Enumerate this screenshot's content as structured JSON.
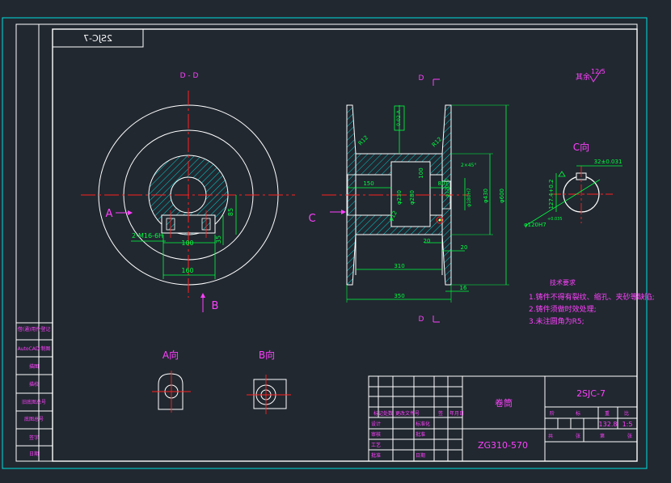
{
  "drawing": {
    "code_mirrored": "2SJC-7",
    "roughness_label": "其余",
    "roughness_value": "12.5",
    "view_dd_title": "D - D",
    "section_letter_d_top": "D",
    "section_letter_d_bottom": "D",
    "arrow_label_a": "A",
    "arrow_label_b": "B",
    "arrow_label_c": "C",
    "view_c_title": "C向",
    "view_a_title": "A向",
    "view_b_title": "B向"
  },
  "dimensions": {
    "dd_thread": "2-M16-6H",
    "dd_100": "100",
    "dd_160": "160",
    "dd_85": "85",
    "dd_35": "35",
    "s_150": "150",
    "s_80": "80",
    "s_20a": "20",
    "s_20b": "20",
    "s_310": "310",
    "s_350": "350",
    "s_16": "16",
    "s_chamfer": "2×45°",
    "s_d230": "φ230",
    "s_d280": "φ280",
    "s_d430": "φ430",
    "s_d600": "φ600",
    "s_d120": "φ120H7",
    "s_d180": "φ180H7",
    "s_100": "100",
    "s_r12": "R12",
    "s_d12": "φ12",
    "s_tol": "0.02 A",
    "c_32": "32±0.031",
    "c_127": "127.4+0.2",
    "c_120": "φ120H7",
    "c_tol": "+0.035"
  },
  "notes": {
    "title": "技术要求",
    "items": [
      "1.铸件不得有裂纹、缩孔、夹砂等缺陷;",
      "2.铸件须做时效处理;",
      "3.未注圆角为R5;"
    ]
  },
  "title_block": {
    "part_name": "卷筒",
    "material": "ZG310-570",
    "drawing_no": "2SJC-7",
    "weight": "132.8",
    "scale": "1:5",
    "hdr_stage": "阶",
    "hdr_mark": "标",
    "hdr_weight": "重",
    "hdr_scale": "比",
    "total_sheets": "共",
    "sheet": "张",
    "sheet_no": "第",
    "sheet_no2": "张",
    "mark_row": [
      "标记",
      "处数",
      "更改文件号",
      "签",
      "年月日"
    ],
    "left_rows": [
      "设计",
      "审核",
      "工艺"
    ],
    "left_rows2": [
      "标准化",
      "批准",
      "日期"
    ],
    "approval_rows": [
      "设计",
      "校对",
      "审核",
      "工艺",
      "标准化",
      "批准"
    ]
  },
  "sidebar": {
    "rows": [
      "借(通)用件登记",
      "AutoCAD 制图",
      "描图",
      "描校",
      "旧底图总号",
      "底图总号",
      "签字",
      "日期"
    ]
  },
  "colors": {
    "background": "#212830",
    "frame": "#00e0e0",
    "outline": "#ffffff",
    "center": "#ff2020",
    "dimension": "#00ff40",
    "text_magenta": "#ff40ff",
    "text_cyan": "#00e0e0",
    "leader": "#ffff40",
    "hatch": "#00e0e0"
  }
}
